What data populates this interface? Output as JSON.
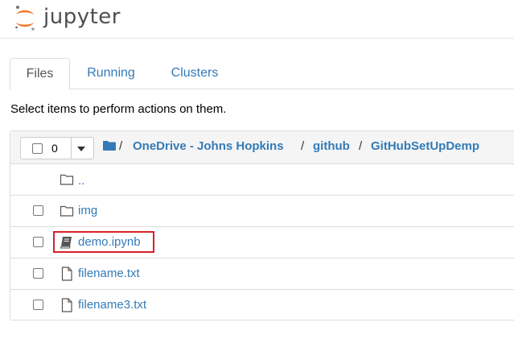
{
  "app": {
    "logo_text": "jupyter",
    "brand_color": "#f37726"
  },
  "tabs": [
    {
      "label": "Files",
      "active": true
    },
    {
      "label": "Running",
      "active": false
    },
    {
      "label": "Clusters",
      "active": false
    }
  ],
  "hint": "Select items to perform actions on them.",
  "toolbar": {
    "selected_count": "0"
  },
  "breadcrumb": {
    "root_icon": "folder-icon",
    "sep": "/",
    "items": [
      "OneDrive - Johns Hopkins",
      "github",
      "GitHubSetUpDemp"
    ]
  },
  "files": [
    {
      "name": "..",
      "icon": "folder-icon",
      "has_checkbox": false
    },
    {
      "name": "img",
      "icon": "folder-icon",
      "has_checkbox": true
    },
    {
      "name": "demo.ipynb",
      "icon": "notebook-icon",
      "has_checkbox": true,
      "highlighted": true
    },
    {
      "name": "filename.txt",
      "icon": "file-icon",
      "has_checkbox": true
    },
    {
      "name": "filename3.txt",
      "icon": "file-icon",
      "has_checkbox": true
    }
  ],
  "colors": {
    "link": "#337ab7",
    "highlight_border": "#d9202a",
    "panel_border": "#dddddd"
  }
}
